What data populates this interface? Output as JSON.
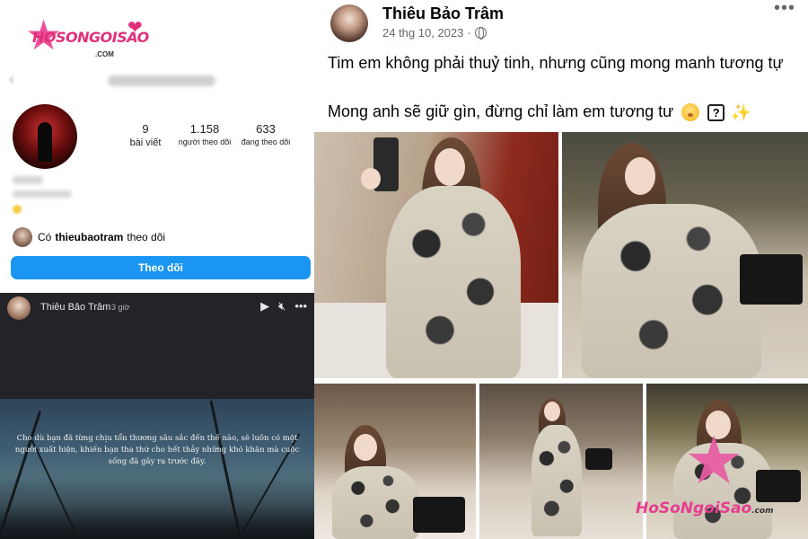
{
  "logo": {
    "brand": "HOSONGOISAO",
    "domain": ".COM",
    "brand_color": "#e0307a"
  },
  "instagram": {
    "stats": [
      {
        "value": "9",
        "label": "bài viết"
      },
      {
        "value": "1.158",
        "label": "người theo dõi"
      },
      {
        "value": "633",
        "label": "đang theo dõi"
      }
    ],
    "followed_by": {
      "prefix": "Có",
      "user": "thieubaotram",
      "suffix": "theo dõi"
    },
    "follow_button": "Theo dõi",
    "accent": "#1a95f2"
  },
  "story": {
    "author": "Thiêu Bảo Trâm",
    "time": "3 giờ",
    "controls": [
      "play-icon",
      "mute-icon",
      "more-icon"
    ],
    "text": "Cho dù bạn đã từng chịu tổn thương sâu sắc đến thế nào, sẽ luôn có một người xuất hiện, khiến bạn tha thứ cho hết thảy những khó khăn mà cuộc sống đã gây ra trước đây."
  },
  "post": {
    "author": "Thiêu Bảo Trâm",
    "date": "24 thg 10, 2023",
    "separator": "·",
    "more": "•••",
    "line1": "Tim em không phải thuỷ tinh, nhưng cũng mong manh tương tự",
    "line2": "Mong anh sẽ giữ gìn, đừng chỉ làm em tương tư",
    "emoji": [
      "face-icon",
      "question-box-icon",
      "sparkles-icon"
    ]
  },
  "watermark": {
    "brand": "HoSoNgoiSao",
    "domain": ".com"
  }
}
